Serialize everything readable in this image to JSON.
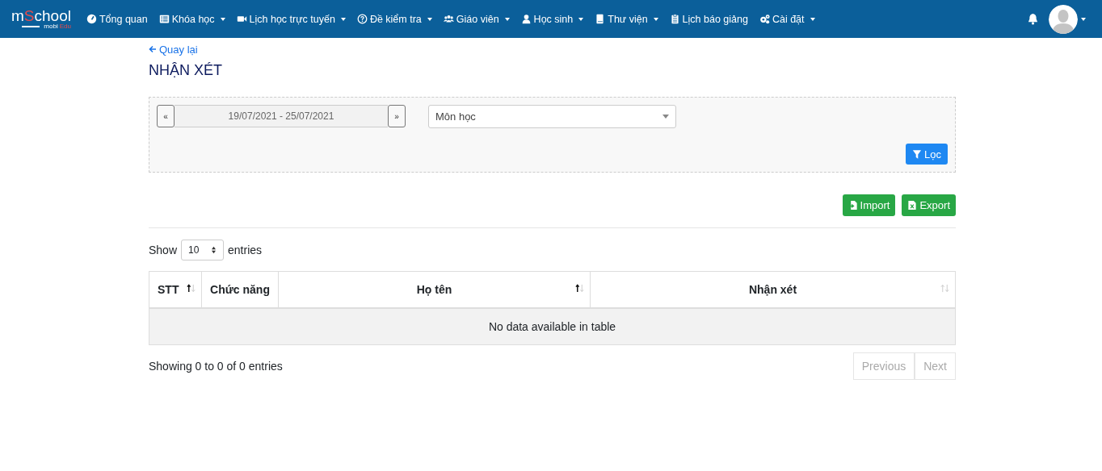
{
  "navbar": {
    "logo": {
      "main_start": "m",
      "main_accent": "S",
      "main_end": "chool",
      "sub_start": "mobi",
      "sub_accent": "Edu"
    },
    "items": [
      {
        "label": "Tổng quan",
        "kind": "gauge",
        "dropdown": false
      },
      {
        "label": "Khóa học",
        "kind": "list",
        "dropdown": true
      },
      {
        "label": "Lịch học trực tuyến",
        "kind": "video",
        "dropdown": true
      },
      {
        "label": "Đề kiểm tra",
        "kind": "question",
        "dropdown": true
      },
      {
        "label": "Giáo viên",
        "kind": "users",
        "dropdown": true
      },
      {
        "label": "Học sinh",
        "kind": "user",
        "dropdown": true
      },
      {
        "label": "Thư viện",
        "kind": "book",
        "dropdown": true
      },
      {
        "label": "Lịch báo giảng",
        "kind": "clipboard",
        "dropdown": false
      },
      {
        "label": "Cài đặt",
        "kind": "gears",
        "dropdown": true
      }
    ]
  },
  "back_link": "Quay lại",
  "title": "NHẬN XÉT",
  "filter": {
    "prev": "«",
    "date_range": "19/07/2021 - 25/07/2021",
    "next": "»",
    "subject_placeholder": "Môn học",
    "button": "Lọc"
  },
  "actions": [
    {
      "label": "Import",
      "kind": "import"
    },
    {
      "label": "Export",
      "kind": "excel"
    }
  ],
  "length": {
    "prefix": "Show",
    "value": "10",
    "suffix": "entries"
  },
  "table": {
    "columns": [
      {
        "label": "STT",
        "sortable": true,
        "sorted": true
      },
      {
        "label": "Chức năng",
        "sortable": false
      },
      {
        "label": "Họ tên",
        "sortable": true,
        "sorted": true
      },
      {
        "label": "Nhận xét",
        "sortable": true,
        "sorted": false
      }
    ],
    "empty": "No data available in table"
  },
  "info": "Showing 0 to 0 of 0 entries",
  "pagination": [
    {
      "label": "Previous",
      "disabled": true
    },
    {
      "label": "Next",
      "disabled": true
    }
  ]
}
